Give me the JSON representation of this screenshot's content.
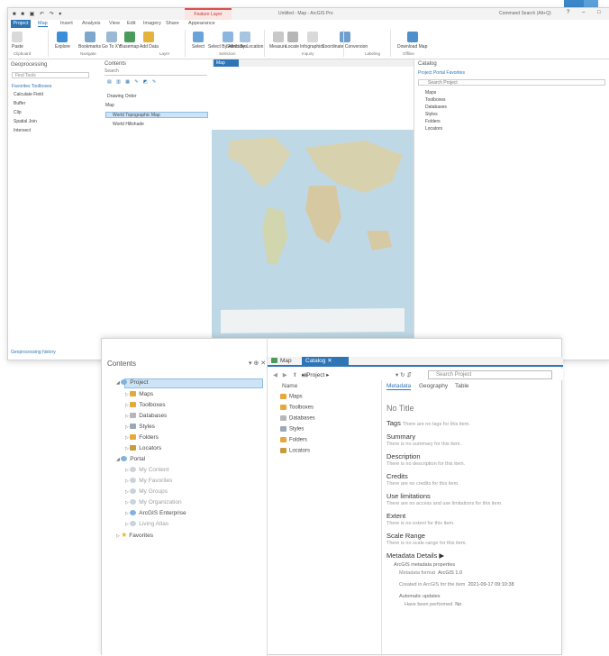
{
  "app": {
    "context_tab": "Feature Layer",
    "title": "Untitled - Map - ArcGIS Pro",
    "search_commands": "Command Search (Alt+Q)"
  },
  "ribbon": {
    "tabs": [
      "Project",
      "Map",
      "Insert",
      "Analysis",
      "View",
      "Edit",
      "Imagery",
      "Share",
      "Appearance"
    ],
    "active_tab": "Map",
    "buttons": [
      "Paste",
      "Explore",
      "Bookmarks",
      "Go To XY",
      "Basemap",
      "Add Data",
      "Select",
      "Select By Attributes",
      "Select By Location",
      "Measure",
      "Locate",
      "Infographics",
      "Coordinate Conversion",
      "Download Map"
    ],
    "groups": [
      "Clipboard",
      "Navigate",
      "Layer",
      "Selection",
      "Inquiry",
      "Labeling",
      "Offline"
    ]
  },
  "geoprocessing": {
    "title": "Geoprocessing",
    "search_placeholder": "Find Tools",
    "tabs": "Favorites  Toolboxes",
    "tools": [
      "Calculate Field",
      "Buffer",
      "Clip",
      "Spatial Join",
      "Intersect"
    ],
    "status": "Geoprocessing history"
  },
  "contents_small": {
    "title": "Contents",
    "search_placeholder": "Search",
    "drawing_order": "Drawing Order",
    "map": "Map",
    "layers": [
      "World Topographic Map",
      "World Hillshade"
    ]
  },
  "map_tab": "Map",
  "catalog_small": {
    "title": "Catalog",
    "subtabs": "Project  Portal  Favorites",
    "search_placeholder": "Search Project",
    "items": [
      "Maps",
      "Toolboxes",
      "Databases",
      "Styles",
      "Folders",
      "Locators"
    ]
  },
  "contents_front": {
    "title": "Contents",
    "project": "Project",
    "project_items": [
      "Maps",
      "Toolboxes",
      "Databases",
      "Styles",
      "Folders",
      "Locators"
    ],
    "portal": "Portal",
    "portal_items": [
      "My Content",
      "My Favorites",
      "My Groups",
      "My Organization",
      "ArcGIS Enterprise",
      "Living Atlas"
    ],
    "favorites": "Favorites"
  },
  "front_tabs": {
    "map": "Map",
    "catalog": "Catalog"
  },
  "breadcrumb": "Project",
  "front_search_placeholder": "Search Project",
  "list": {
    "column": "Name",
    "items": [
      "Maps",
      "Toolboxes",
      "Databases",
      "Styles",
      "Folders",
      "Locators"
    ]
  },
  "metadata": {
    "tabs": [
      "Metadata",
      "Geography",
      "Table"
    ],
    "title": "No Title",
    "tags_label": "Tags",
    "tags_value": "There are no tags for this item.",
    "summary_label": "Summary",
    "summary_value": "There is no summary for this item.",
    "description_label": "Description",
    "description_value": "There is no description for this item.",
    "credits_label": "Credits",
    "credits_value": "There are no credits for this item.",
    "use_label": "Use limitations",
    "use_value": "There are no access and use limitations for this item.",
    "extent_label": "Extent",
    "extent_value": "There is no extent for this item.",
    "scale_label": "Scale Range",
    "scale_value": "There is no scale range for this item.",
    "details_label": "Metadata Details",
    "props_label": "ArcGIS metadata properties",
    "format_label": "Metadata format",
    "format_value": "ArcGIS 1.0",
    "created_label": "Created in ArcGIS for the item",
    "created_value": "2021-09-17   09:10:38",
    "auto_label": "Automatic updates",
    "performed_label": "Have been performed",
    "performed_value": "No"
  }
}
